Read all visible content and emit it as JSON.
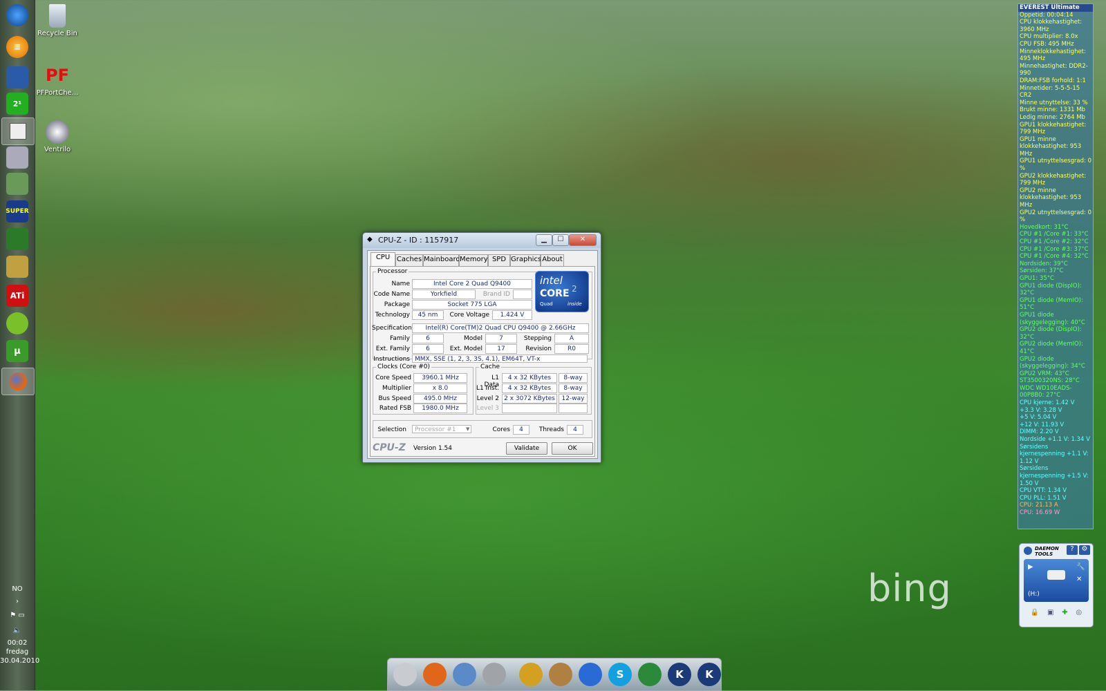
{
  "desktop": {
    "icons": [
      {
        "label": "Recycle Bin",
        "icon": "recycle-bin-icon"
      },
      {
        "label": "PFPortChe...",
        "icon": "pfportchecker-icon"
      },
      {
        "label": "Ventrilo",
        "icon": "ventrilo-icon"
      }
    ],
    "watermark": "bing"
  },
  "taskbar": {
    "items": [
      {
        "icon": "start-orb-icon"
      },
      {
        "icon": "menu-icon"
      },
      {
        "icon": "cpu-z-icon"
      },
      {
        "icon": "2p1-icon"
      },
      {
        "icon": "window-app-icon"
      },
      {
        "icon": "drive-icon"
      },
      {
        "icon": "image-app-icon"
      },
      {
        "icon": "superpi-icon"
      },
      {
        "icon": "memory-icon"
      },
      {
        "icon": "tools-icon"
      },
      {
        "icon": "ati-icon"
      },
      {
        "icon": "spotify-icon"
      },
      {
        "icon": "utorrent-icon"
      },
      {
        "icon": "firefox-icon"
      }
    ],
    "language": "NO",
    "time": "00:02",
    "day": "fredag",
    "date": "30.04.2010"
  },
  "cpuz": {
    "title": "CPU-Z - ID : 1157917",
    "tabs": [
      "CPU",
      "Caches",
      "Mainboard",
      "Memory",
      "SPD",
      "Graphics",
      "About"
    ],
    "processor": {
      "legend": "Processor",
      "name_label": "Name",
      "name": "Intel Core 2 Quad Q9400",
      "codename_label": "Code Name",
      "codename": "Yorkfield",
      "brandid_label": "Brand ID",
      "package_label": "Package",
      "package": "Socket 775 LGA",
      "technology_label": "Technology",
      "technology": "45 nm",
      "corevoltage_label": "Core Voltage",
      "corevoltage": "1.424 V",
      "spec_label": "Specification",
      "spec": "Intel(R) Core(TM)2 Quad CPU    Q9400  @ 2.66GHz",
      "family_label": "Family",
      "family": "6",
      "model_label": "Model",
      "model": "7",
      "stepping_label": "Stepping",
      "stepping": "A",
      "extfamily_label": "Ext. Family",
      "extfamily": "6",
      "extmodel_label": "Ext. Model",
      "extmodel": "17",
      "revision_label": "Revision",
      "revision": "R0",
      "instructions_label": "Instructions",
      "instructions": "MMX, SSE (1, 2, 3, 3S, 4.1), EM64T, VT-x"
    },
    "logo": {
      "brand": "intel",
      "line1": "CORE",
      "line2": "2",
      "line3": "Quad",
      "line4": "inside"
    },
    "clocks": {
      "legend": "Clocks (Core #0)",
      "corespeed_label": "Core Speed",
      "corespeed": "3960.1 MHz",
      "multiplier_label": "Multiplier",
      "multiplier": "x 8.0",
      "busspeed_label": "Bus Speed",
      "busspeed": "495.0 MHz",
      "ratedfsb_label": "Rated FSB",
      "ratedfsb": "1980.0 MHz"
    },
    "cache": {
      "legend": "Cache",
      "l1data_label": "L1 Data",
      "l1data": "4 x 32 KBytes",
      "l1data_way": "8-way",
      "l1inst_label": "L1 Inst.",
      "l1inst": "4 x 32 KBytes",
      "l1inst_way": "8-way",
      "level2_label": "Level 2",
      "level2": "2 x 3072 KBytes",
      "level2_way": "12-way",
      "level3_label": "Level 3"
    },
    "selection_label": "Selection",
    "selection": "Processor #1",
    "cores_label": "Cores",
    "cores": "4",
    "threads_label": "Threads",
    "threads": "4",
    "brand_text": "CPU-Z",
    "version": "Version 1.54",
    "validate": "Validate",
    "ok": "OK"
  },
  "everest": {
    "title": "EVEREST Ultimate",
    "rows": [
      {
        "text": "Oppetid: 00:04:14",
        "color": "#ffff66"
      },
      {
        "text": "CPU klokkehastighet: 3960 MHz",
        "color": "#ffff66"
      },
      {
        "text": "CPU multiplier: 8.0x",
        "color": "#ffff66"
      },
      {
        "text": "CPU FSB: 495 MHz",
        "color": "#ffff66"
      },
      {
        "text": "Minneklokkehastighet: 495 MHz",
        "color": "#ffff66"
      },
      {
        "text": "Minnehastighet: DDR2-990",
        "color": "#ffff66"
      },
      {
        "text": "DRAM:FSB forhold: 1:1",
        "color": "#ffff66"
      },
      {
        "text": "Minnetider: 5-5-5-15 CR2",
        "color": "#ffff66"
      },
      {
        "text": "Minne utnyttelse: 33 %",
        "color": "#ffff66"
      },
      {
        "text": "Brukt minne: 1331 Mb",
        "color": "#ffff66"
      },
      {
        "text": "Ledig minne: 2764 Mb",
        "color": "#ffff66"
      },
      {
        "text": "GPU1 klokkehastighet: 799 MHz",
        "color": "#ffff66"
      },
      {
        "text": "GPU1 minne klokkehastighet: 953 MHz",
        "color": "#ffff66"
      },
      {
        "text": "GPU1 utnyttelsesgrad: 0 %",
        "color": "#ffff66"
      },
      {
        "text": "GPU2 klokkehastighet: 799 MHz",
        "color": "#ffff66"
      },
      {
        "text": "GPU2 minne klokkehastighet: 953 MHz",
        "color": "#ffff66"
      },
      {
        "text": "GPU2 utnyttelsesgrad: 0 %",
        "color": "#ffff66"
      },
      {
        "text": "Hovedkort: 31°C",
        "color": "#66ff66"
      },
      {
        "text": "CPU #1 /Core #1: 33°C",
        "color": "#66ff66"
      },
      {
        "text": "CPU #1 /Core #2: 32°C",
        "color": "#66ff66"
      },
      {
        "text": "CPU #1 /Core #3: 37°C",
        "color": "#66ff66"
      },
      {
        "text": "CPU #1 /Core #4: 32°C",
        "color": "#66ff66"
      },
      {
        "text": "Nordsiden: 39°C",
        "color": "#66ff66"
      },
      {
        "text": "Sørsiden: 37°C",
        "color": "#66ff66"
      },
      {
        "text": "GPU1: 35°C",
        "color": "#66ff66"
      },
      {
        "text": "GPU1 diode (DispIO): 32°C",
        "color": "#66ff66"
      },
      {
        "text": "GPU1 diode (MemIO): 51°C",
        "color": "#66ff66"
      },
      {
        "text": "GPU1 diode (skyggelegging): 40°C",
        "color": "#66ff66"
      },
      {
        "text": "GPU2 diode (DispIO): 32°C",
        "color": "#66ff66"
      },
      {
        "text": "GPU2 diode (MemIO): 41°C",
        "color": "#66ff66"
      },
      {
        "text": "GPU2 diode (skyggelegging): 34°C",
        "color": "#66ff66"
      },
      {
        "text": "GPU2 VRM: 43°C",
        "color": "#66ff66"
      },
      {
        "text": "ST3500320NS: 28°C",
        "color": "#66ff66"
      },
      {
        "text": "WDC WD10EADS-00P8B0: 27°C",
        "color": "#66ff66"
      },
      {
        "text": "CPU kjerne: 1.42 V",
        "color": "#66ffff"
      },
      {
        "text": "+3.3 V: 3.28 V",
        "color": "#66ffff"
      },
      {
        "text": "+5 V: 5.04 V",
        "color": "#66ffff"
      },
      {
        "text": "+12 V: 11.93 V",
        "color": "#66ffff"
      },
      {
        "text": "DIMM: 2.20 V",
        "color": "#66ffff"
      },
      {
        "text": "Nordside +1.1 V: 1.34 V",
        "color": "#66ffff"
      },
      {
        "text": "Sørsidens kjernespenning +1.1 V: 1.12 V",
        "color": "#66ffff"
      },
      {
        "text": "Sørsidens kjernespenning +1.5 V: 1.50 V",
        "color": "#66ffff"
      },
      {
        "text": "CPU VTT: 1.34 V",
        "color": "#66ffff"
      },
      {
        "text": "CPU PLL: 1.51 V",
        "color": "#66ffff"
      },
      {
        "text": "CPU: 21.13 A",
        "color": "#ffbb66"
      },
      {
        "text": "CPU: 16.69 W",
        "color": "#ff99cc"
      }
    ]
  },
  "daemon": {
    "title": "DAEMON TOOLS",
    "drive": "(H:)",
    "help": "?"
  },
  "dock": {
    "items": [
      {
        "icon": "finder-icon",
        "color": "#c8ccd0"
      },
      {
        "icon": "firefox-icon",
        "color": "#e0661a"
      },
      {
        "icon": "network-globe-icon",
        "color": "#5b8ac8"
      },
      {
        "icon": "tools-icon",
        "color": "#a0a4a8"
      },
      {
        "icon": "lightning-tool-icon",
        "color": "#d4a020"
      },
      {
        "icon": "hammer-icon",
        "color": "#b08040"
      },
      {
        "icon": "thunder-icon",
        "color": "#2a6ad4"
      },
      {
        "icon": "skype-icon",
        "color": "#12a0e0"
      },
      {
        "icon": "green-arrows-icon",
        "color": "#2a8a3a"
      },
      {
        "icon": "k-app-icon-1",
        "color": "#1a3a78"
      },
      {
        "icon": "k-app-icon-2",
        "color": "#1a3a78"
      }
    ],
    "k_label": "K",
    "s_label": "S"
  }
}
